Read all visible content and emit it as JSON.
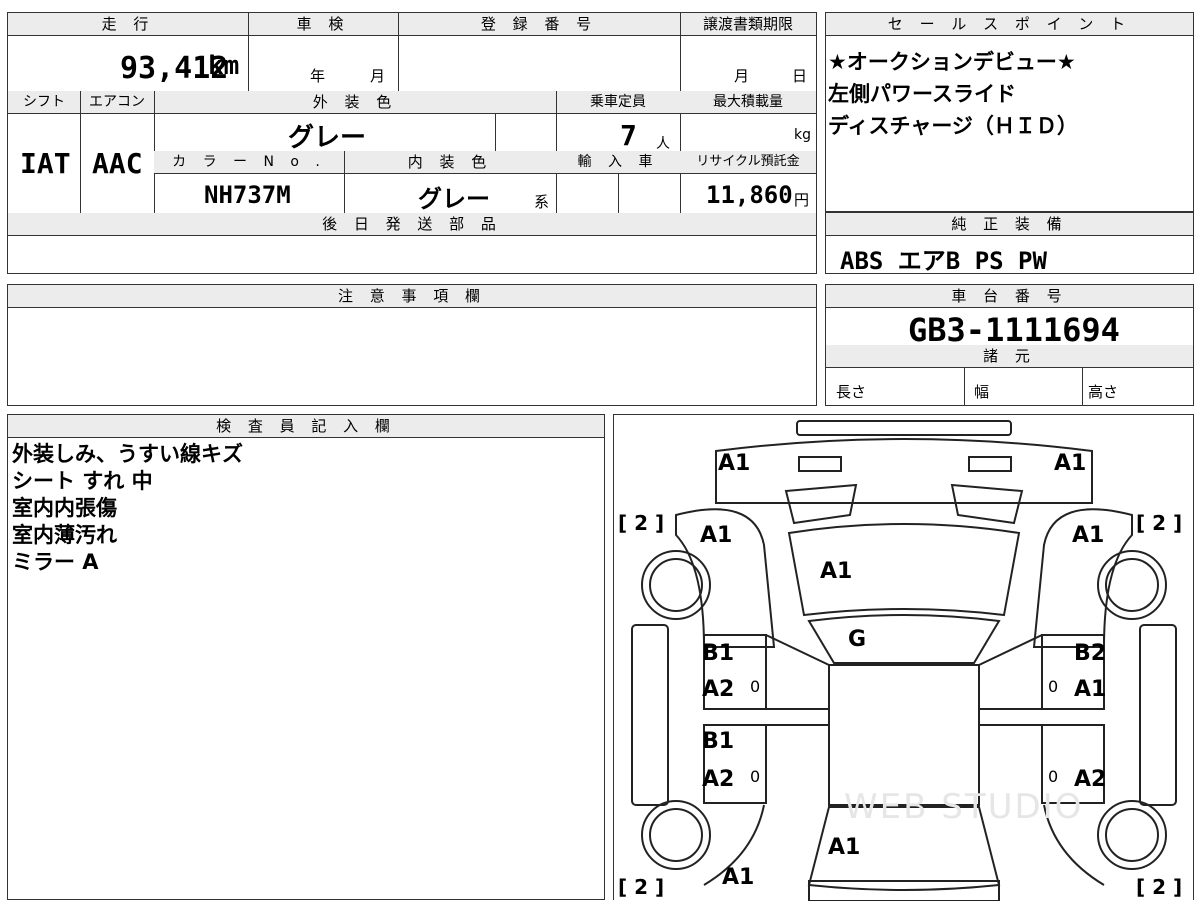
{
  "vehicle": {
    "mileage_label": "走 行",
    "mileage_value": "93,412",
    "mileage_unit": "km",
    "inspection_label": "車 検",
    "inspection_year_unit": "年",
    "inspection_month_unit": "月",
    "registration_label": "登 録 番 号",
    "transfer_deadline_label": "譲渡書類期限",
    "transfer_month_unit": "月",
    "transfer_day_unit": "日",
    "shift_label": "シフト",
    "shift_value": "IAT",
    "aircon_label": "エアコン",
    "aircon_value": "AAC",
    "exterior_color_label": "外 装 色",
    "exterior_color_value": "グレー",
    "capacity_label": "乗車定員",
    "capacity_value": "7",
    "capacity_unit": "人",
    "max_load_label": "最大積載量",
    "max_load_unit": "kg",
    "color_no_label": "カ ラ ー  N o .",
    "color_no_value": "NH737M",
    "interior_color_label": "内 装 色",
    "interior_color_value": "グレー",
    "interior_color_suffix": "系",
    "import_label": "輸 入 車",
    "recycle_label": "リサイクル預託金",
    "recycle_value": "11,860",
    "recycle_unit": "円",
    "later_parts_label": "後 日 発 送 部 品"
  },
  "sales_points": {
    "label": "セ ー ル ス ポ イ ン ト",
    "lines": [
      "★オークションデビュー★",
      "左側パワースライド",
      "ディスチャージ（ＨＩＤ）"
    ]
  },
  "equipment": {
    "label": "純 正 装 備",
    "value": "ABS エアB PS PW"
  },
  "caution": {
    "label": "注 意 事 項 欄"
  },
  "chassis": {
    "label": "車 台 番 号",
    "value": "GB3-1111694",
    "specs_label": "諸 元",
    "length_label": "長さ",
    "width_label": "幅",
    "height_label": "高さ"
  },
  "inspector": {
    "label": "検 査 員 記 入 欄",
    "notes": [
      "外装しみ、うすい線キズ",
      "シート すれ 中",
      "室内内張傷",
      "室内薄汚れ",
      "ミラー A"
    ]
  },
  "diagram": {
    "marks": [
      {
        "id": "front-left",
        "text": "A1"
      },
      {
        "id": "front-right",
        "text": "A1"
      },
      {
        "id": "fender-left",
        "text": "A1"
      },
      {
        "id": "fender-right",
        "text": "A1"
      },
      {
        "id": "hood",
        "text": "A1"
      },
      {
        "id": "windshield",
        "text": "G"
      },
      {
        "id": "front-door-left-1",
        "text": "B1"
      },
      {
        "id": "front-door-left-2",
        "text": "A2"
      },
      {
        "id": "front-door-right-1",
        "text": "B2"
      },
      {
        "id": "front-door-right-2",
        "text": "A1"
      },
      {
        "id": "rear-door-left-1",
        "text": "B1"
      },
      {
        "id": "rear-door-left-2",
        "text": "A2"
      },
      {
        "id": "rear-door-right",
        "text": "A2"
      },
      {
        "id": "roof-rear",
        "text": "A1"
      },
      {
        "id": "quarter-left",
        "text": "A1"
      }
    ],
    "tire_brackets": [
      "[ 2 ]",
      "[ 2 ]",
      "[ 2 ]",
      "[ 2 ]"
    ],
    "zero_marks": [
      "0",
      "0",
      "0",
      "0"
    ],
    "watermark": "WEB STUDIO"
  }
}
